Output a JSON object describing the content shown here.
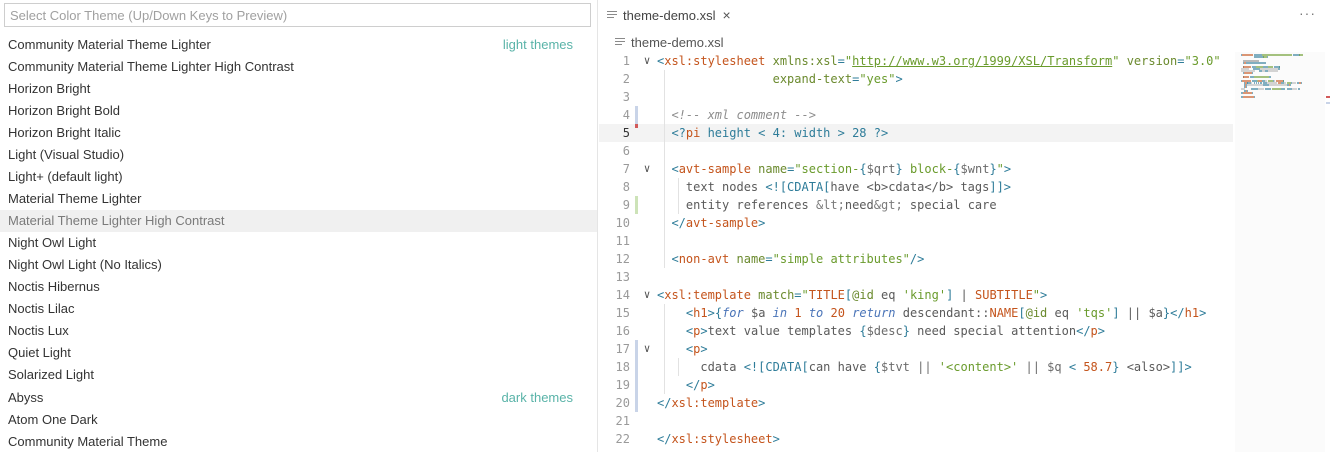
{
  "picker": {
    "placeholder": "Select Color Theme (Up/Down Keys to Preview)",
    "items": [
      {
        "label": "Community Material Theme Lighter",
        "group": "light themes"
      },
      {
        "label": "Community Material Theme Lighter High Contrast"
      },
      {
        "label": "Horizon Bright"
      },
      {
        "label": "Horizon Bright Bold"
      },
      {
        "label": "Horizon Bright Italic"
      },
      {
        "label": "Light (Visual Studio)"
      },
      {
        "label": "Light+ (default light)"
      },
      {
        "label": "Material Theme Lighter"
      },
      {
        "label": "Material Theme Lighter High Contrast",
        "selected": true
      },
      {
        "label": "Night Owl Light"
      },
      {
        "label": "Night Owl Light (No Italics)"
      },
      {
        "label": "Noctis Hibernus"
      },
      {
        "label": "Noctis Lilac"
      },
      {
        "label": "Noctis Lux"
      },
      {
        "label": "Quiet Light"
      },
      {
        "label": "Solarized Light"
      },
      {
        "label": "Abyss",
        "group": "dark themes"
      },
      {
        "label": "Atom One Dark"
      },
      {
        "label": "Community Material Theme"
      }
    ]
  },
  "editor": {
    "tab_label": "theme-demo.xsl",
    "close_glyph": "×",
    "more_glyph": "···",
    "breadcrumb": "theme-demo.xsl",
    "line_numbers": [
      "1",
      "2",
      "3",
      "4",
      "5",
      "6",
      "7",
      "8",
      "9",
      "10",
      "11",
      "12",
      "13",
      "14",
      "15",
      "16",
      "17",
      "18",
      "19",
      "20",
      "21",
      "22"
    ],
    "lines": [
      [
        [
          "punc",
          "<"
        ],
        [
          "tag",
          "xsl:stylesheet"
        ],
        [
          "plain",
          " "
        ],
        [
          "attr",
          "xmlns:xsl"
        ],
        [
          "punc",
          "="
        ],
        [
          "str",
          "\""
        ],
        [
          "url",
          "http://www.w3.org/1999/XSL/Transform"
        ],
        [
          "str",
          "\""
        ],
        [
          "plain",
          " "
        ],
        [
          "attr",
          "version"
        ],
        [
          "punc",
          "="
        ],
        [
          "str",
          "\"3.0\""
        ]
      ],
      [
        [
          "plain",
          "                "
        ],
        [
          "attr",
          "expand-text"
        ],
        [
          "punc",
          "="
        ],
        [
          "str",
          "\"yes\""
        ],
        [
          "punc",
          ">"
        ]
      ],
      [],
      [
        [
          "plain",
          "  "
        ],
        [
          "cmt",
          "<!-- xml comment -->"
        ]
      ],
      [
        [
          "plain",
          "  "
        ],
        [
          "pi",
          "<?"
        ],
        [
          "tag",
          "pi"
        ],
        [
          "pi",
          " height < 4: width > 28 ?>"
        ]
      ],
      [],
      [
        [
          "plain",
          "  "
        ],
        [
          "punc",
          "<"
        ],
        [
          "tag",
          "avt-sample"
        ],
        [
          "plain",
          " "
        ],
        [
          "attr",
          "name"
        ],
        [
          "punc",
          "="
        ],
        [
          "str",
          "\"section-"
        ],
        [
          "brace",
          "{"
        ],
        [
          "var",
          "$qrt"
        ],
        [
          "brace",
          "}"
        ],
        [
          "str",
          " block-"
        ],
        [
          "brace",
          "{"
        ],
        [
          "var",
          "$wnt"
        ],
        [
          "brace",
          "}"
        ],
        [
          "str",
          "\""
        ],
        [
          "punc",
          ">"
        ]
      ],
      [
        [
          "plain",
          "    text nodes "
        ],
        [
          "punc",
          "<![CDATA["
        ],
        [
          "plain",
          "have <b>cdata</b> tags"
        ],
        [
          "punc",
          "]]>"
        ]
      ],
      [
        [
          "plain",
          "    entity references "
        ],
        [
          "entity",
          "&lt;"
        ],
        [
          "plain",
          "need"
        ],
        [
          "entity",
          "&gt;"
        ],
        [
          "plain",
          " special care"
        ]
      ],
      [
        [
          "plain",
          "  "
        ],
        [
          "punc",
          "</"
        ],
        [
          "tag",
          "avt-sample"
        ],
        [
          "punc",
          ">"
        ]
      ],
      [],
      [
        [
          "plain",
          "  "
        ],
        [
          "punc",
          "<"
        ],
        [
          "tag",
          "non-avt"
        ],
        [
          "plain",
          " "
        ],
        [
          "attr",
          "name"
        ],
        [
          "punc",
          "="
        ],
        [
          "str",
          "\"simple attributes\""
        ],
        [
          "punc",
          "/>"
        ]
      ],
      [],
      [
        [
          "punc",
          "<"
        ],
        [
          "tag",
          "xsl:template"
        ],
        [
          "plain",
          " "
        ],
        [
          "attr",
          "match"
        ],
        [
          "punc",
          "="
        ],
        [
          "str",
          "\""
        ],
        [
          "tag",
          "TITLE"
        ],
        [
          "punc",
          "["
        ],
        [
          "attr",
          "@id"
        ],
        [
          "plain",
          " eq "
        ],
        [
          "str",
          "'king'"
        ],
        [
          "punc",
          "]"
        ],
        [
          "plain",
          " | "
        ],
        [
          "tag",
          "SUBTITLE"
        ],
        [
          "str",
          "\""
        ],
        [
          "punc",
          ">"
        ]
      ],
      [
        [
          "plain",
          "    "
        ],
        [
          "punc",
          "<"
        ],
        [
          "tag",
          "h1"
        ],
        [
          "punc",
          ">"
        ],
        [
          "brace",
          "{"
        ],
        [
          "kw",
          "for"
        ],
        [
          "plain",
          " $a "
        ],
        [
          "kw",
          "in"
        ],
        [
          "plain",
          " "
        ],
        [
          "num",
          "1"
        ],
        [
          "plain",
          " "
        ],
        [
          "kw",
          "to"
        ],
        [
          "plain",
          " "
        ],
        [
          "num",
          "20"
        ],
        [
          "plain",
          " "
        ],
        [
          "kw",
          "return"
        ],
        [
          "plain",
          " descendant::"
        ],
        [
          "tag",
          "NAME"
        ],
        [
          "punc",
          "["
        ],
        [
          "attr",
          "@id"
        ],
        [
          "plain",
          " eq "
        ],
        [
          "str",
          "'tqs'"
        ],
        [
          "punc",
          "]"
        ],
        [
          "plain",
          " || $a"
        ],
        [
          "brace",
          "}"
        ],
        [
          "punc",
          "</"
        ],
        [
          "tag",
          "h1"
        ],
        [
          "punc",
          ">"
        ]
      ],
      [
        [
          "plain",
          "    "
        ],
        [
          "punc",
          "<"
        ],
        [
          "tag",
          "p"
        ],
        [
          "punc",
          ">"
        ],
        [
          "plain",
          "text value templates "
        ],
        [
          "brace",
          "{"
        ],
        [
          "var",
          "$desc"
        ],
        [
          "brace",
          "}"
        ],
        [
          "plain",
          " need special attention"
        ],
        [
          "punc",
          "</"
        ],
        [
          "tag",
          "p"
        ],
        [
          "punc",
          ">"
        ]
      ],
      [
        [
          "plain",
          "    "
        ],
        [
          "punc",
          "<"
        ],
        [
          "tag",
          "p"
        ],
        [
          "punc",
          ">"
        ]
      ],
      [
        [
          "plain",
          "      cdata "
        ],
        [
          "punc",
          "<![CDATA["
        ],
        [
          "plain",
          "can have "
        ],
        [
          "brace",
          "{"
        ],
        [
          "var",
          "$tvt || "
        ],
        [
          "str",
          "'<content>'"
        ],
        [
          "var",
          " || $q "
        ],
        [
          "punc",
          "<"
        ],
        [
          "plain",
          " "
        ],
        [
          "num",
          "58.7"
        ],
        [
          "brace",
          "}"
        ],
        [
          "plain",
          " <also>"
        ],
        [
          "punc",
          "]]>"
        ]
      ],
      [
        [
          "plain",
          "    "
        ],
        [
          "punc",
          "</"
        ],
        [
          "tag",
          "p"
        ],
        [
          "punc",
          ">"
        ]
      ],
      [
        [
          "punc",
          "</"
        ],
        [
          "tag",
          "xsl:template"
        ],
        [
          "punc",
          ">"
        ]
      ],
      [],
      [
        [
          "punc",
          "</"
        ],
        [
          "tag",
          "xsl:stylesheet"
        ],
        [
          "punc",
          ">"
        ]
      ]
    ]
  },
  "colors": {
    "accent_group_label": "#59b3a8",
    "selected_row_bg": "#f0f0f0",
    "current_line_bg": "#f3f3f3",
    "gutter_modified": "#c9d4e8",
    "gutter_added": "#cde3b8",
    "gutter_deleted": "#d25a5a"
  }
}
